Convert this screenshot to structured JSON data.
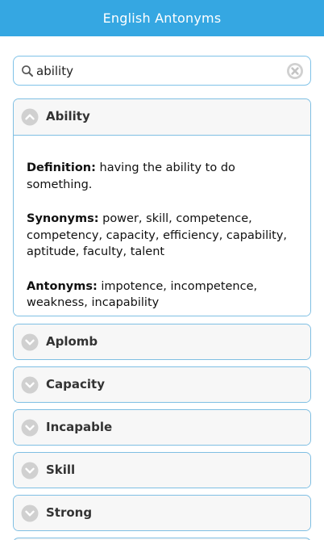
{
  "header": {
    "title": "English Antonyms"
  },
  "search": {
    "value": "ability",
    "icon": "search-icon",
    "clear_icon": "clear-icon"
  },
  "expanded": {
    "label": "Ability",
    "definition_label": "Definition:",
    "definition": " having the ability to do something.",
    "synonyms_label": "Synonyms:",
    "synonyms": " power, skill, competence, competency, capacity, efficiency, capability, aptitude, faculty, talent",
    "antonyms_label": "Antonyms:",
    "antonyms": " impotence, incompetence, weakness, incapability"
  },
  "items": [
    {
      "label": "Aplomb"
    },
    {
      "label": "Capacity"
    },
    {
      "label": "Incapable"
    },
    {
      "label": "Skill"
    },
    {
      "label": "Strong"
    }
  ],
  "colors": {
    "header_bg": "#35a7e2",
    "border": "#7fbfe3",
    "item_bg": "#f7f7f7",
    "icon_grey": "#d0d0d0"
  }
}
